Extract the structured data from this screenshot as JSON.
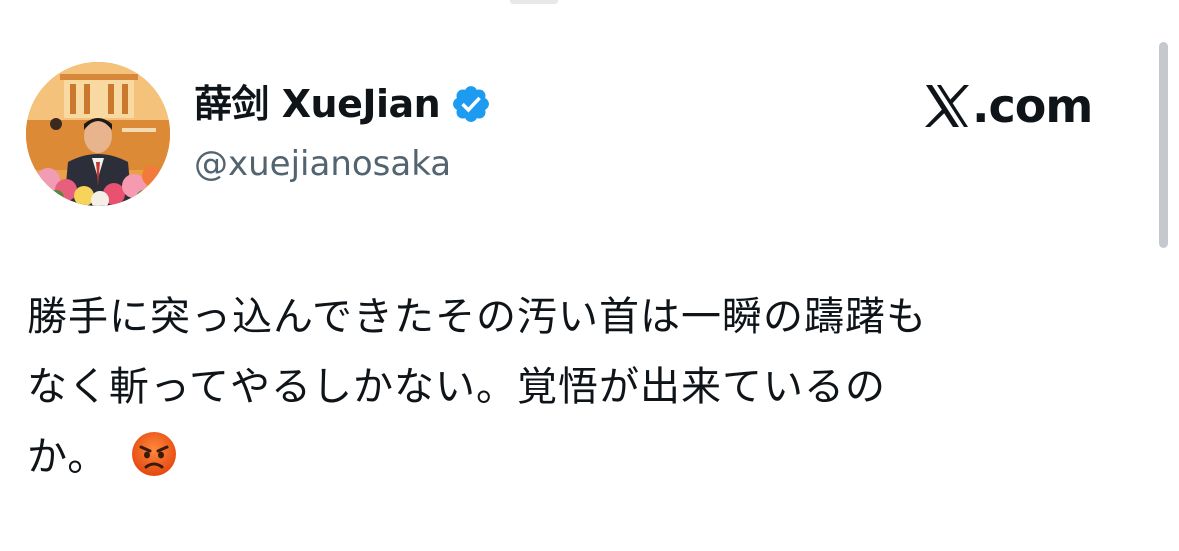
{
  "tweet": {
    "author": {
      "display_name": "薛剑 XueJian",
      "handle": "@xuejianosaka",
      "verified": true,
      "verified_icon": "verified-badge-icon",
      "avatar": "profile-photo-avatar"
    },
    "site": {
      "logo_icon": "x-logo-icon",
      "label": ".com"
    },
    "text_lines": [
      "勝手に突っ込んできたその汚い首は一瞬の躊躇も",
      "なく斬ってやるしかない。覚悟が出来ているの",
      "か。"
    ],
    "emoji": "angry-face-emoji"
  },
  "colors": {
    "text_primary": "#0f1419",
    "text_secondary": "#536471",
    "verified_blue": "#1d9bf0",
    "scrollbar": "#c5c9cd",
    "emoji_orange": "#f26a1b"
  }
}
